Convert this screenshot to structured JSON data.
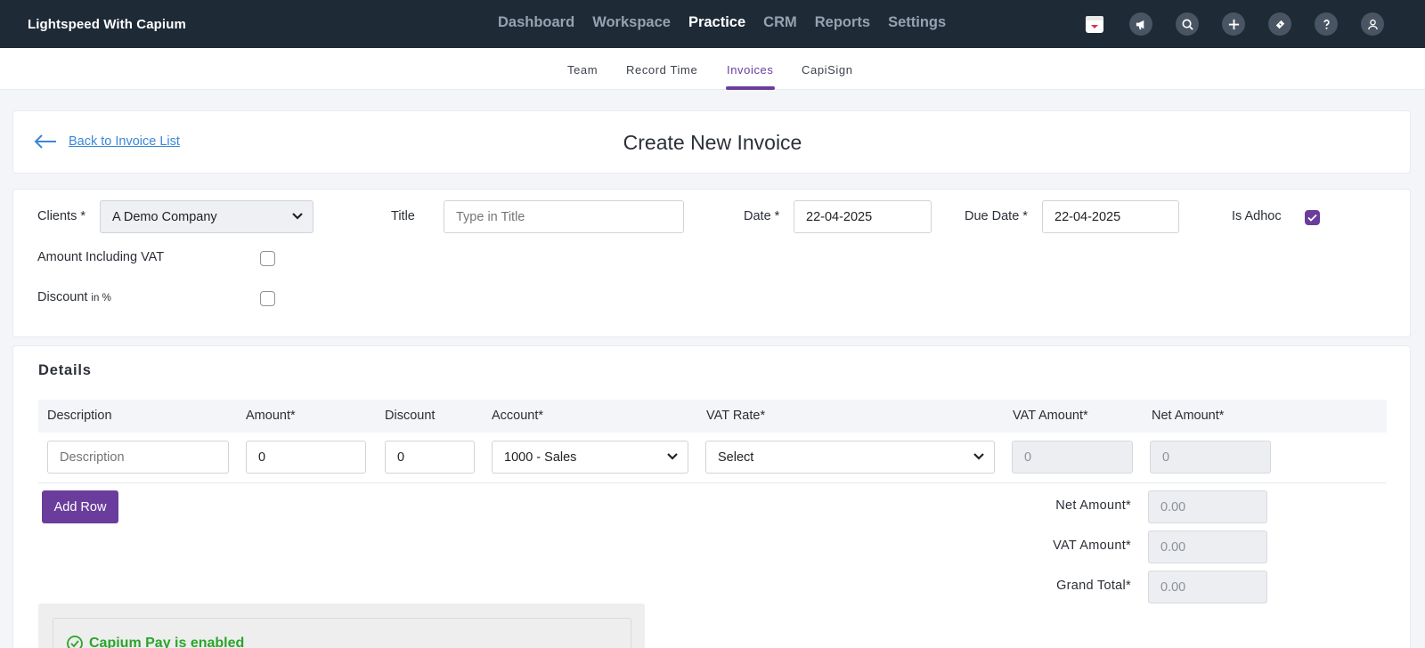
{
  "brand": "Lightspeed With Capium",
  "nav": [
    {
      "label": "Dashboard",
      "active": false
    },
    {
      "label": "Workspace",
      "active": false
    },
    {
      "label": "Practice",
      "active": true
    },
    {
      "label": "CRM",
      "active": false
    },
    {
      "label": "Reports",
      "active": false
    },
    {
      "label": "Settings",
      "active": false
    }
  ],
  "top_icons": [
    "calendar-icon",
    "megaphone-icon",
    "search-icon",
    "plus-icon",
    "ticket-icon",
    "help-icon",
    "user-icon"
  ],
  "subnav": [
    {
      "label": "Team",
      "active": false
    },
    {
      "label": "Record Time",
      "active": false
    },
    {
      "label": "Invoices",
      "active": true
    },
    {
      "label": "CapiSign",
      "active": false
    }
  ],
  "header": {
    "back_label": "Back to Invoice List",
    "title": "Create New Invoice"
  },
  "form": {
    "clients_label": "Clients *",
    "clients_value": "A Demo Company",
    "title_label": "Title",
    "title_placeholder": "Type in Title",
    "date_label": "Date *",
    "date_value": "22-04-2025",
    "due_date_label": "Due Date *",
    "due_date_value": "22-04-2025",
    "adhoc_label": "Is Adhoc",
    "adhoc_checked": true,
    "vat_incl_label": "Amount Including VAT",
    "vat_incl_checked": false,
    "discount_label": "Discount",
    "discount_hint": "in %",
    "discount_checked": false
  },
  "details": {
    "title": "Details",
    "columns": [
      "Description",
      "Amount*",
      "Discount",
      "Account*",
      "VAT Rate*",
      "VAT Amount*",
      "Net Amount*"
    ],
    "row": {
      "description_placeholder": "Description",
      "amount": "0",
      "discount": "0",
      "account": "1000 - Sales",
      "vat_rate": "Select",
      "vat_amount": "0",
      "net_amount": "0"
    },
    "add_row_label": "Add Row",
    "totals": [
      {
        "label": "Net Amount*",
        "value": "0.00"
      },
      {
        "label": "VAT Amount*",
        "value": "0.00"
      },
      {
        "label": "Grand Total*",
        "value": "0.00"
      }
    ],
    "capium_pay": "Capium Pay is enabled"
  },
  "colors": {
    "topbar": "#1f2a37",
    "accent": "#6a3d9c",
    "link": "#3a87d8",
    "success": "#2aa52a"
  }
}
